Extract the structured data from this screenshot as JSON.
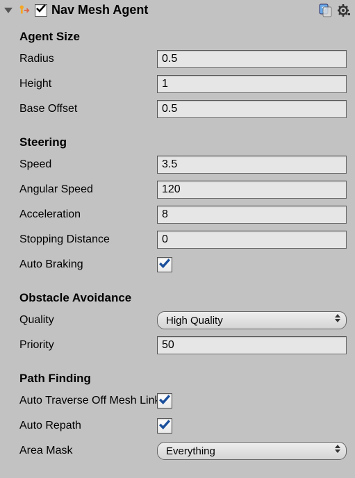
{
  "header": {
    "title": "Nav Mesh Agent",
    "enabled": true
  },
  "agentSize": {
    "heading": "Agent Size",
    "radiusLabel": "Radius",
    "radiusValue": "0.5",
    "heightLabel": "Height",
    "heightValue": "1",
    "baseOffsetLabel": "Base Offset",
    "baseOffsetValue": "0.5"
  },
  "steering": {
    "heading": "Steering",
    "speedLabel": "Speed",
    "speedValue": "3.5",
    "angularSpeedLabel": "Angular Speed",
    "angularSpeedValue": "120",
    "accelerationLabel": "Acceleration",
    "accelerationValue": "8",
    "stoppingDistanceLabel": "Stopping Distance",
    "stoppingDistanceValue": "0",
    "autoBrakingLabel": "Auto Braking",
    "autoBrakingValue": true
  },
  "obstacleAvoidance": {
    "heading": "Obstacle Avoidance",
    "qualityLabel": "Quality",
    "qualityValue": "High Quality",
    "priorityLabel": "Priority",
    "priorityValue": "50"
  },
  "pathFinding": {
    "heading": "Path Finding",
    "autoTraverseLabel": "Auto Traverse Off Mesh Link",
    "autoTraverseValue": true,
    "autoRepathLabel": "Auto Repath",
    "autoRepathValue": true,
    "areaMaskLabel": "Area Mask",
    "areaMaskValue": "Everything"
  }
}
